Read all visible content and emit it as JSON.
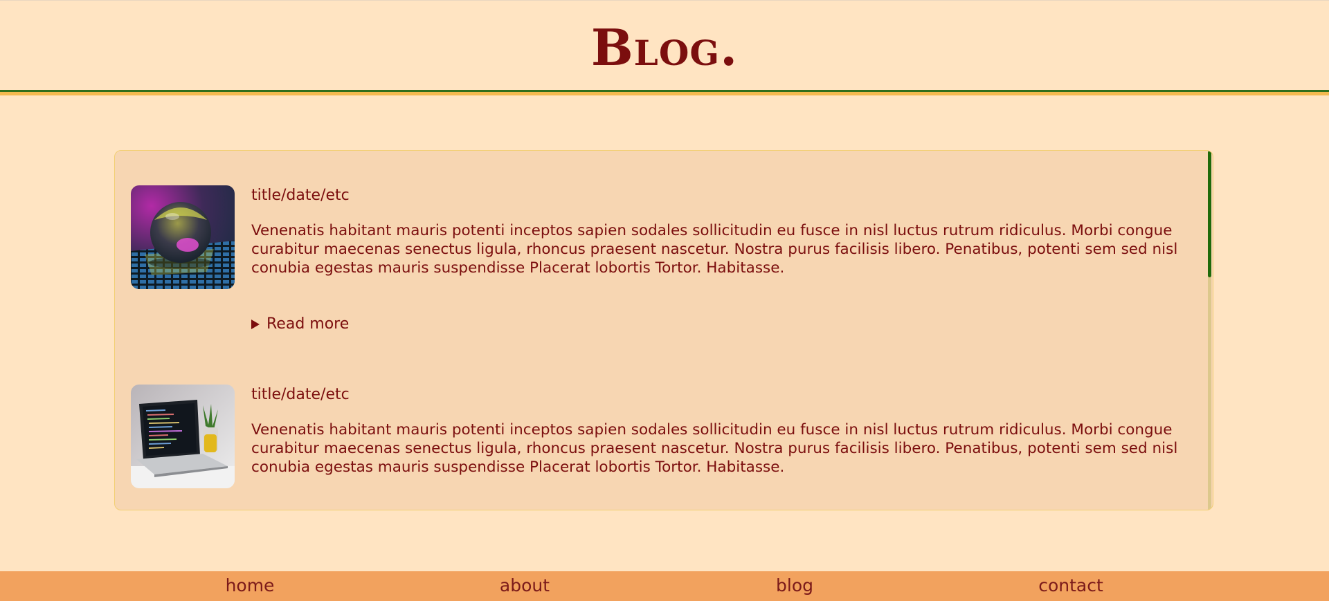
{
  "header": {
    "title": "Blog."
  },
  "posts": [
    {
      "meta": "title/date/etc",
      "body": "Venenatis habitant mauris potenti inceptos sapien sodales sollicitudin eu fusce in nisl luctus rutrum ridiculus. Morbi congue curabitur maecenas senectus ligula, rhoncus praesent nascetur. Nostra purus facilisis libero. Penatibus, potenti sem sed nisl conubia egestas mauris suspendisse Placerat lobortis Tortor. Habitasse.",
      "read_more": "Read more",
      "image_icon": "glass-sphere-image"
    },
    {
      "meta": "title/date/etc",
      "body": "Venenatis habitant mauris potenti inceptos sapien sodales sollicitudin eu fusce in nisl luctus rutrum ridiculus. Morbi congue curabitur maecenas senectus ligula, rhoncus praesent nascetur. Nostra purus facilisis libero. Penatibus, potenti sem sed nisl conubia egestas mauris suspendisse Placerat lobortis Tortor. Habitasse.",
      "image_icon": "laptop-image"
    }
  ],
  "nav": {
    "home": "home",
    "about": "about",
    "blog": "blog",
    "contact": "contact"
  },
  "colors": {
    "background": "#ffe4c2",
    "title": "#7b0e0e",
    "panel": "#f7d6b2",
    "footer": "#f2a25e",
    "rule_green": "#2f6e1b",
    "rule_gold": "#f4b94f",
    "scroll_thumb": "#1f6a0a"
  }
}
